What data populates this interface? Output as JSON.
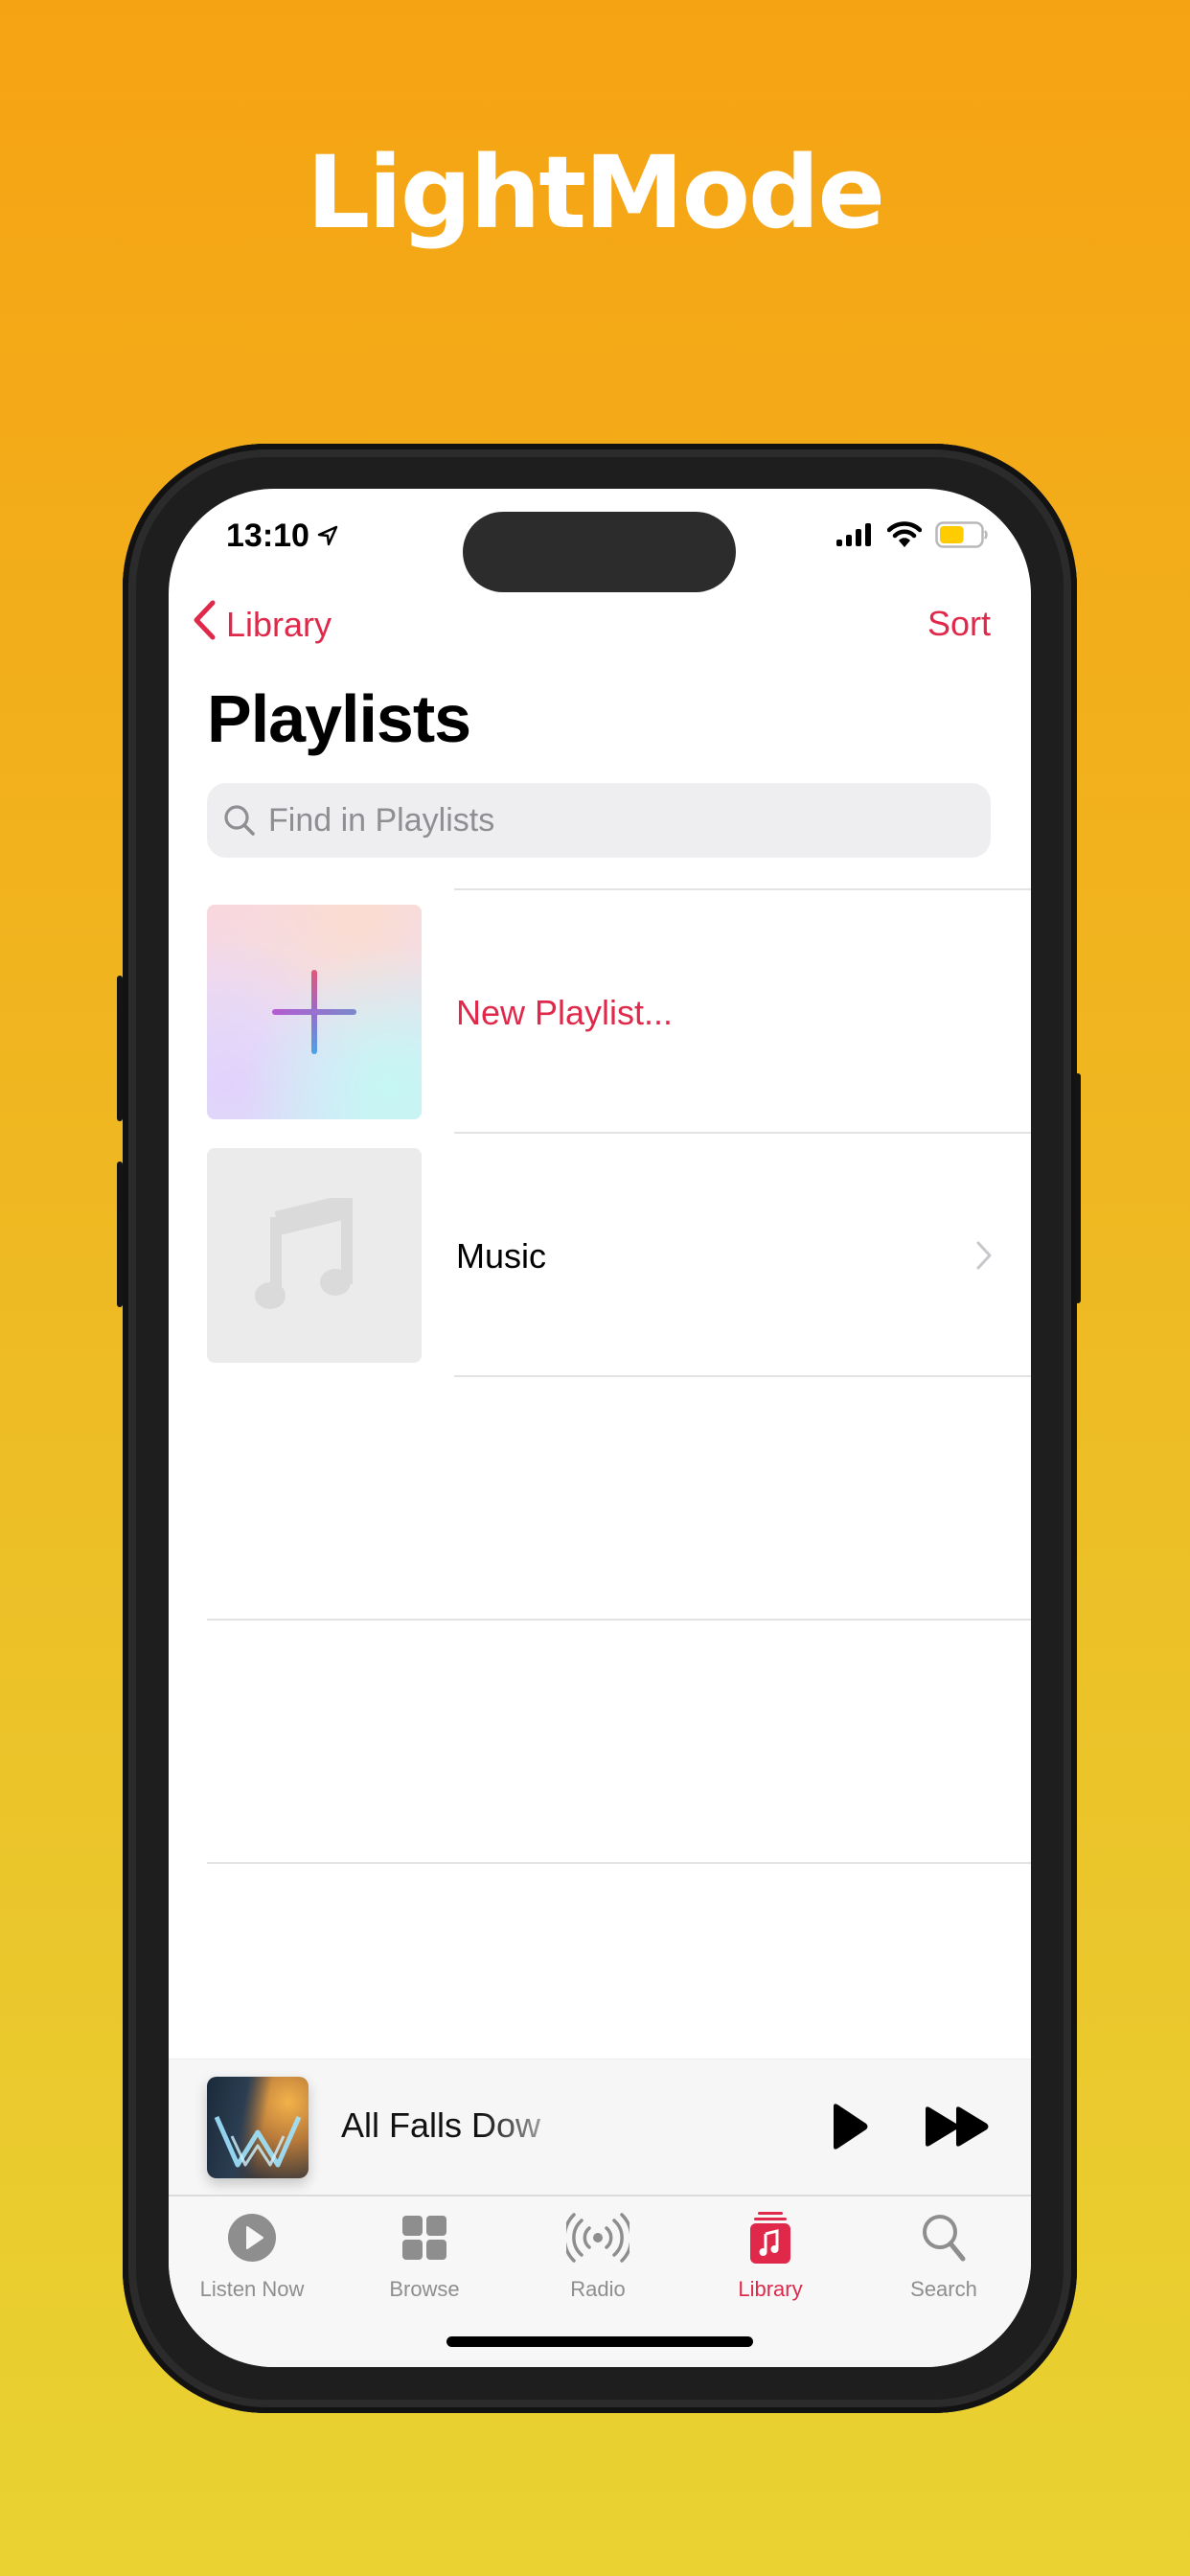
{
  "hero": {
    "title": "LightMode"
  },
  "colors": {
    "accent": "#E0294A",
    "background_top": "#F6A313",
    "background_bottom": "#E9D232",
    "battery": "#FFCC00"
  },
  "status_bar": {
    "time": "13:10",
    "location_icon": "location-arrow-icon",
    "signal_icon": "cellular-signal-icon",
    "wifi_icon": "wifi-icon",
    "battery_icon": "battery-icon",
    "battery_level_percent": 60,
    "low_power_mode": true
  },
  "nav": {
    "back_label": "Library",
    "back_icon": "chevron-left-icon",
    "sort_label": "Sort"
  },
  "page": {
    "title": "Playlists"
  },
  "search": {
    "placeholder": "Find in Playlists",
    "value": "",
    "icon": "search-icon"
  },
  "playlists": [
    {
      "label": "New Playlist...",
      "type": "action",
      "icon": "plus-icon"
    },
    {
      "label": "Music",
      "type": "playlist",
      "icon": "music-note-icon",
      "has_chevron": true
    }
  ],
  "mini_player": {
    "title": "All Falls Dow",
    "play_icon": "play-icon",
    "forward_icon": "fast-forward-icon"
  },
  "tab_bar": {
    "tabs": [
      {
        "label": "Listen Now",
        "icon": "play-circle-icon",
        "active": false
      },
      {
        "label": "Browse",
        "icon": "grid-icon",
        "active": false
      },
      {
        "label": "Radio",
        "icon": "radio-broadcast-icon",
        "active": false
      },
      {
        "label": "Library",
        "icon": "library-music-icon",
        "active": true
      },
      {
        "label": "Search",
        "icon": "search-icon",
        "active": false
      }
    ]
  }
}
